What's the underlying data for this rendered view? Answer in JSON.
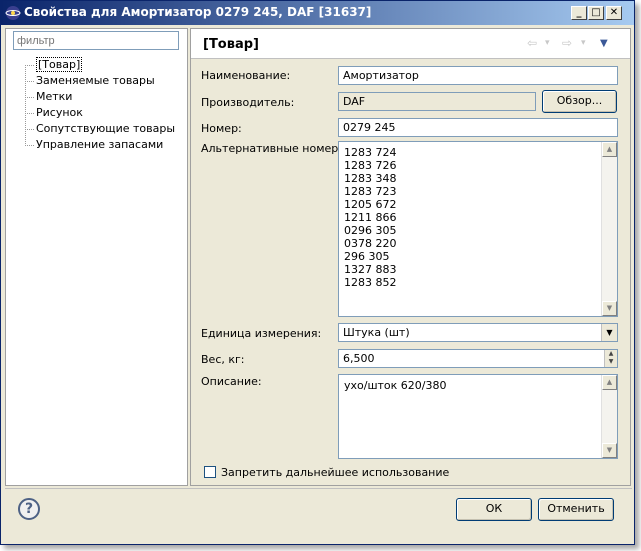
{
  "window": {
    "title": "Свойства для Амортизатор 0279 245, DAF [31637]",
    "min_glyph": "_",
    "max_glyph": "□",
    "close_glyph": "✕"
  },
  "filter": {
    "placeholder": "фильтр"
  },
  "tree": {
    "items": [
      {
        "label": "[Товар]",
        "selected": true
      },
      {
        "label": "Заменяемые товары"
      },
      {
        "label": "Метки"
      },
      {
        "label": "Рисунок"
      },
      {
        "label": "Сопутствующие товары"
      },
      {
        "label": "Управление запасами"
      }
    ]
  },
  "page": {
    "title": "[Товар]",
    "nav": {
      "back_glyph": "⇦",
      "forward_glyph": "⇨",
      "menu_glyph": "▾",
      "dropdown_glyph": "▼"
    }
  },
  "form": {
    "name_label": "Наименование:",
    "name_value": "Амортизатор",
    "manufacturer_label": "Производитель:",
    "manufacturer_value": "DAF",
    "browse_label": "Обзор...",
    "number_label": "Номер:",
    "number_value": "0279 245",
    "alt_numbers_label": "Альтернативные номера:",
    "alt_numbers": [
      "1283 724",
      "1283 726",
      "1283 348",
      "1283 723",
      "1205 672",
      "1211 866",
      "0296 305",
      "0378 220",
      "296 305",
      "1327 883",
      "1283 852"
    ],
    "unit_label": "Единица измерения:",
    "unit_value": "Штука (шт)",
    "weight_label": "Вес, кг:",
    "weight_value": "6,500",
    "description_label": "Описание:",
    "description_value": "ухо/шток 620/380",
    "disable_label": "Запретить дальнейшее использование",
    "disable_checked": false
  },
  "footer": {
    "help_glyph": "?",
    "ok_label": "ОК",
    "cancel_label": "Отменить"
  },
  "colors": {
    "titlebar_start": "#0a246a",
    "titlebar_end": "#a6caf0",
    "dialog_bg": "#ece9d8"
  }
}
